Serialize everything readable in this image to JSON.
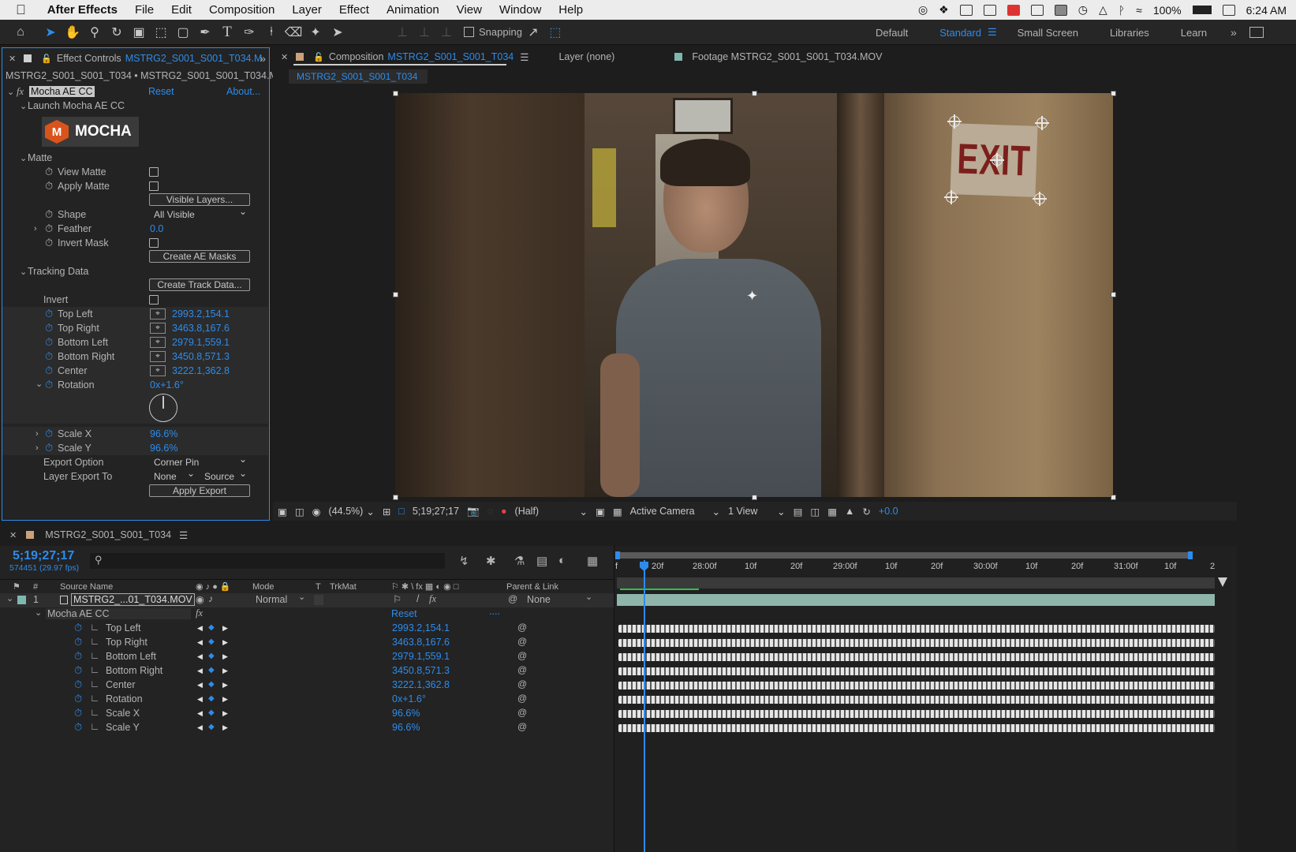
{
  "menubar": {
    "app": "After Effects",
    "items": [
      "File",
      "Edit",
      "Composition",
      "Layer",
      "Effect",
      "Animation",
      "View",
      "Window",
      "Help"
    ],
    "battery": "100%",
    "time": "6:24 AM"
  },
  "toolbar": {
    "snapping_label": "Snapping",
    "workspaces": [
      "Default",
      "Standard",
      "Small Screen",
      "Libraries",
      "Learn"
    ],
    "current_workspace": "Standard"
  },
  "effect_controls": {
    "tab_prefix": "Effect Controls",
    "tab_layer": "MSTRG2_S001_S001_T034.M",
    "path": "MSTRG2_S001_S001_T034 • MSTRG2_S001_S001_T034.MOV",
    "effect_name": "Mocha AE CC",
    "reset": "Reset",
    "about": "About...",
    "launch": "Launch Mocha AE CC",
    "logo_text": "MOCHA",
    "logo_letter": "M",
    "matte": "Matte",
    "view_matte": "View Matte",
    "apply_matte": "Apply Matte",
    "visible_layers_btn": "Visible Layers...",
    "shape": "Shape",
    "shape_value": "All Visible",
    "feather": "Feather",
    "feather_value": "0.0",
    "invert_mask": "Invert Mask",
    "create_masks_btn": "Create AE Masks",
    "tracking_data": "Tracking Data",
    "create_track_btn": "Create Track Data...",
    "invert": "Invert",
    "params": [
      {
        "label": "Top Left",
        "value": "2993.2,154.1"
      },
      {
        "label": "Top Right",
        "value": "3463.8,167.6"
      },
      {
        "label": "Bottom Left",
        "value": "2979.1,559.1"
      },
      {
        "label": "Bottom Right",
        "value": "3450.8,571.3"
      },
      {
        "label": "Center",
        "value": "3222.1,362.8"
      }
    ],
    "rotation": "Rotation",
    "rotation_value": "0x+1.6°",
    "scale_x": "Scale X",
    "scale_x_value": "96.6%",
    "scale_y": "Scale Y",
    "scale_y_value": "96.6%",
    "export_option": "Export Option",
    "export_option_value": "Corner Pin",
    "layer_export_to": "Layer Export To",
    "layer_export_none": "None",
    "layer_export_source": "Source",
    "apply_export_btn": "Apply Export"
  },
  "composition": {
    "tab_prefix": "Composition",
    "tab_name": "MSTRG2_S001_S001_T034",
    "layer_tab": "Layer (none)",
    "footage_tab": "Footage MSTRG2_S001_S001_T034.MOV",
    "subtab": "MSTRG2_S001_S001_T034",
    "sign_text": "EXIT",
    "zoom": "(44.5%)",
    "timecode": "5;19;27;17",
    "resolution": "(Half)",
    "camera": "Active Camera",
    "views": "1 View",
    "exposure": "+0.0"
  },
  "timeline": {
    "comp_name": "MSTRG2_S001_S001_T034",
    "timecode": "5;19;27;17",
    "frames": "574451 (29.97 fps)",
    "ruler": [
      "f",
      "20f",
      "28:00f",
      "10f",
      "20f",
      "29:00f",
      "10f",
      "20f",
      "30:00f",
      "10f",
      "20f",
      "31:00f",
      "10f",
      "2"
    ],
    "col_hash": "#",
    "col_source": "Source Name",
    "col_mode": "Mode",
    "col_t": "T",
    "col_trkmat": "TrkMat",
    "col_parent": "Parent & Link",
    "layer_num": "1",
    "layer_name": "MSTRG2_...01_T034.MOV",
    "layer_mode": "Normal",
    "layer_parent": "None",
    "effect_name": "Mocha AE CC",
    "effect_reset": "Reset",
    "effect_dots": "....",
    "props": [
      {
        "label": "Top Left",
        "value": "2993.2,154.1"
      },
      {
        "label": "Top Right",
        "value": "3463.8,167.6"
      },
      {
        "label": "Bottom Left",
        "value": "2979.1,559.1"
      },
      {
        "label": "Bottom Right",
        "value": "3450.8,571.3"
      },
      {
        "label": "Center",
        "value": "3222.1,362.8"
      },
      {
        "label": "Rotation",
        "value": "0x+1.6°"
      },
      {
        "label": "Scale X",
        "value": "96.6%"
      },
      {
        "label": "Scale Y",
        "value": "96.6%"
      }
    ]
  },
  "colors": {
    "accent": "#2d8ceb",
    "panel": "#232323",
    "bg": "#1d1d1d",
    "layer_bar": "#8fb5ab"
  }
}
